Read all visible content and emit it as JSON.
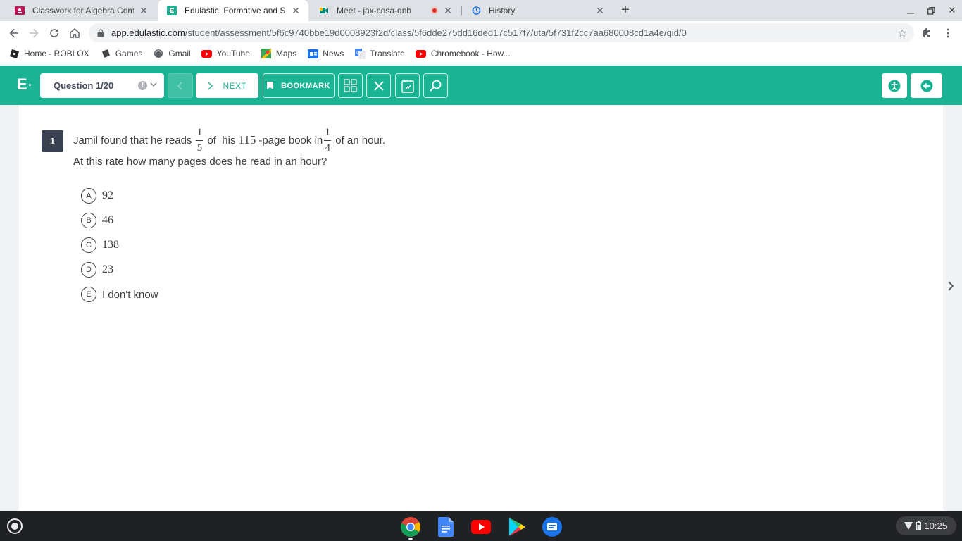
{
  "browser": {
    "tabs": [
      {
        "title": "Classwork for Algebra Common",
        "active": false
      },
      {
        "title": "Edulastic: Formative and Summ",
        "active": true
      },
      {
        "title": "Meet - jax-cosa-qnb",
        "active": false,
        "recording": true
      },
      {
        "title": "History",
        "active": false
      }
    ],
    "url_host": "app.edulastic.com",
    "url_path": "/student/assessment/5f6c9740bbe19d0008923f2d/class/5f6dde275dd16ded17c517f7/uta/5f731f2cc7aa680008cd1a4e/qid/0",
    "bookmarks": [
      {
        "label": "Home - ROBLOX",
        "icon": "roblox-icon"
      },
      {
        "label": "Games",
        "icon": "games-icon"
      },
      {
        "label": "Gmail",
        "icon": "gmail-icon"
      },
      {
        "label": "YouTube",
        "icon": "youtube-icon"
      },
      {
        "label": "Maps",
        "icon": "maps-icon"
      },
      {
        "label": "News",
        "icon": "news-icon"
      },
      {
        "label": "Translate",
        "icon": "translate-icon"
      },
      {
        "label": "Chromebook - How...",
        "icon": "youtube-icon"
      }
    ]
  },
  "header": {
    "logo": "E",
    "question_select": "Question 1/20",
    "next_label": "NEXT",
    "bookmark_label": "BOOKMARK",
    "accent_color": "#1ab394"
  },
  "question": {
    "number": "1",
    "text_part1": "Jamil found that he reads",
    "frac1_num": "1",
    "frac1_den": "5",
    "text_part2": "of  his",
    "pages": "115",
    "text_part3": "-page book in",
    "frac2_num": "1",
    "frac2_den": "4",
    "text_part4": "of an hour.",
    "line2": "At this rate how many pages does he read in an hour?",
    "choices": [
      {
        "letter": "A",
        "text": "92"
      },
      {
        "letter": "B",
        "text": "46"
      },
      {
        "letter": "C",
        "text": "138"
      },
      {
        "letter": "D",
        "text": "23"
      },
      {
        "letter": "E",
        "text": "I don't know"
      }
    ]
  },
  "shelf": {
    "time": "10:25",
    "apps": [
      "chrome-icon",
      "docs-icon",
      "youtube-icon",
      "play-store-icon",
      "messages-icon"
    ]
  }
}
